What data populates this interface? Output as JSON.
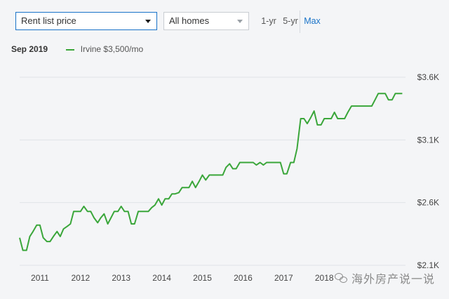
{
  "controls": {
    "metric_select": {
      "value": "Rent list price"
    },
    "home_type_select": {
      "value": "All homes"
    },
    "ranges": [
      {
        "label": "1-yr",
        "active": false
      },
      {
        "label": "5-yr",
        "active": false
      },
      {
        "label": "Max",
        "active": true
      }
    ]
  },
  "legend": {
    "date": "Sep 2019",
    "series_label": "Irvine $3,500/mo"
  },
  "watermark": {
    "text": "海外房产说一说"
  },
  "colors": {
    "series": "#3aa63a",
    "accent": "#1a73c8",
    "grid": "#e0e3e7"
  },
  "chart_data": {
    "type": "line",
    "x_ticks": [
      "2011",
      "2012",
      "2013",
      "2014",
      "2015",
      "2016",
      "2017",
      "2018"
    ],
    "y_ticks": [
      "$2.1K",
      "$2.6K",
      "$3.1K",
      "$3.6K"
    ],
    "y_tick_values": [
      2100,
      2600,
      3100,
      3600
    ],
    "ylim": [
      2100,
      3600
    ],
    "xlim": [
      2010.5,
      2020.0
    ],
    "grid": "horizontal",
    "series": [
      {
        "name": "Irvine",
        "points": [
          [
            2010.5,
            2320
          ],
          [
            2010.58,
            2220
          ],
          [
            2010.67,
            2220
          ],
          [
            2010.75,
            2330
          ],
          [
            2010.83,
            2370
          ],
          [
            2010.92,
            2420
          ],
          [
            2011.0,
            2420
          ],
          [
            2011.08,
            2320
          ],
          [
            2011.17,
            2290
          ],
          [
            2011.25,
            2290
          ],
          [
            2011.33,
            2330
          ],
          [
            2011.42,
            2370
          ],
          [
            2011.5,
            2330
          ],
          [
            2011.58,
            2390
          ],
          [
            2011.67,
            2410
          ],
          [
            2011.75,
            2430
          ],
          [
            2011.83,
            2530
          ],
          [
            2011.92,
            2530
          ],
          [
            2012.0,
            2530
          ],
          [
            2012.08,
            2570
          ],
          [
            2012.17,
            2530
          ],
          [
            2012.25,
            2530
          ],
          [
            2012.33,
            2480
          ],
          [
            2012.42,
            2440
          ],
          [
            2012.5,
            2480
          ],
          [
            2012.58,
            2510
          ],
          [
            2012.67,
            2430
          ],
          [
            2012.75,
            2480
          ],
          [
            2012.83,
            2530
          ],
          [
            2012.92,
            2530
          ],
          [
            2013.0,
            2570
          ],
          [
            2013.08,
            2530
          ],
          [
            2013.17,
            2530
          ],
          [
            2013.25,
            2430
          ],
          [
            2013.33,
            2430
          ],
          [
            2013.42,
            2530
          ],
          [
            2013.5,
            2530
          ],
          [
            2013.58,
            2530
          ],
          [
            2013.67,
            2530
          ],
          [
            2013.75,
            2560
          ],
          [
            2013.83,
            2580
          ],
          [
            2013.92,
            2630
          ],
          [
            2014.0,
            2580
          ],
          [
            2014.08,
            2630
          ],
          [
            2014.17,
            2630
          ],
          [
            2014.25,
            2670
          ],
          [
            2014.33,
            2670
          ],
          [
            2014.42,
            2680
          ],
          [
            2014.5,
            2720
          ],
          [
            2014.58,
            2720
          ],
          [
            2014.67,
            2720
          ],
          [
            2014.75,
            2770
          ],
          [
            2014.83,
            2720
          ],
          [
            2014.92,
            2770
          ],
          [
            2015.0,
            2820
          ],
          [
            2015.08,
            2780
          ],
          [
            2015.17,
            2820
          ],
          [
            2015.25,
            2820
          ],
          [
            2015.33,
            2820
          ],
          [
            2015.42,
            2820
          ],
          [
            2015.5,
            2820
          ],
          [
            2015.58,
            2880
          ],
          [
            2015.67,
            2910
          ],
          [
            2015.75,
            2870
          ],
          [
            2015.83,
            2870
          ],
          [
            2015.92,
            2920
          ],
          [
            2016.0,
            2920
          ],
          [
            2016.08,
            2920
          ],
          [
            2016.17,
            2920
          ],
          [
            2016.25,
            2920
          ],
          [
            2016.33,
            2900
          ],
          [
            2016.42,
            2920
          ],
          [
            2016.5,
            2900
          ],
          [
            2016.58,
            2920
          ],
          [
            2016.67,
            2920
          ],
          [
            2016.75,
            2920
          ],
          [
            2016.83,
            2920
          ],
          [
            2016.92,
            2920
          ],
          [
            2017.0,
            2830
          ],
          [
            2017.08,
            2830
          ],
          [
            2017.17,
            2920
          ],
          [
            2017.25,
            2920
          ],
          [
            2017.33,
            3030
          ],
          [
            2017.42,
            3270
          ],
          [
            2017.5,
            3270
          ],
          [
            2017.58,
            3230
          ],
          [
            2017.67,
            3280
          ],
          [
            2017.75,
            3330
          ],
          [
            2017.83,
            3220
          ],
          [
            2017.92,
            3220
          ],
          [
            2018.0,
            3270
          ],
          [
            2018.08,
            3270
          ],
          [
            2018.17,
            3270
          ],
          [
            2018.25,
            3320
          ],
          [
            2018.33,
            3270
          ],
          [
            2018.42,
            3270
          ],
          [
            2018.5,
            3270
          ],
          [
            2018.58,
            3320
          ],
          [
            2018.67,
            3370
          ],
          [
            2018.75,
            3370
          ],
          [
            2018.83,
            3370
          ],
          [
            2018.92,
            3370
          ],
          [
            2019.0,
            3370
          ],
          [
            2019.08,
            3370
          ],
          [
            2019.17,
            3370
          ],
          [
            2019.25,
            3420
          ],
          [
            2019.33,
            3470
          ],
          [
            2019.42,
            3470
          ],
          [
            2019.5,
            3470
          ],
          [
            2019.58,
            3420
          ],
          [
            2019.67,
            3420
          ],
          [
            2019.75,
            3470
          ],
          [
            2019.83,
            3470
          ],
          [
            2019.92,
            3470
          ]
        ]
      }
    ]
  }
}
